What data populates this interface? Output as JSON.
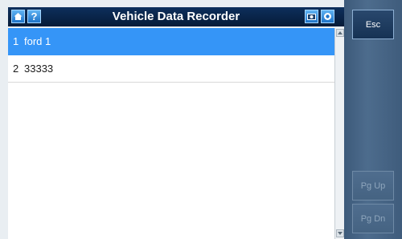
{
  "header": {
    "title": "Vehicle Data Recorder",
    "home_icon": "home-icon",
    "help_label": "?",
    "camera_icon": "camera-icon",
    "record_icon": "record-icon"
  },
  "list": {
    "items": [
      {
        "index": "1",
        "name": "ford 1",
        "selected": true
      },
      {
        "index": "2",
        "name": "33333",
        "selected": false
      }
    ]
  },
  "side": {
    "esc_label": "Esc",
    "pgup_label": "Pg Up",
    "pgdn_label": "Pg Dn"
  },
  "colors": {
    "selection": "#3595f7",
    "titlebar": "#0d2f5c",
    "side_panel": "#4d6c8d"
  }
}
